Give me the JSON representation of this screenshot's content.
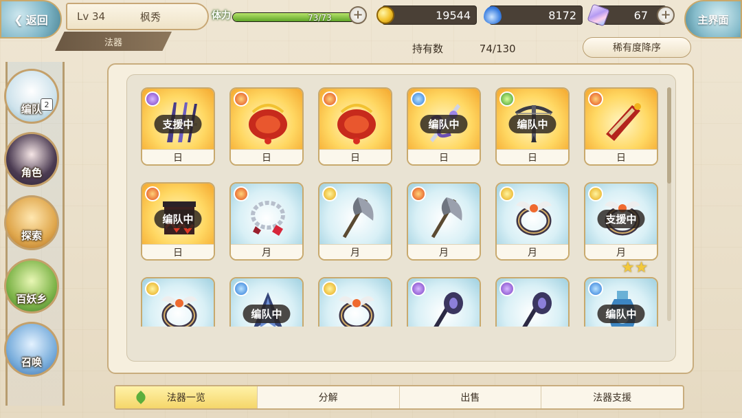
{
  "header": {
    "back_label": "返回",
    "level": "Lv 34",
    "player_name": "枫秀",
    "section": "法器",
    "stamina_label": "体力",
    "stamina_value": "73/73",
    "stamina_fraction": 1.0,
    "gold": "19544",
    "spirit": "8172",
    "gems": "67",
    "main_label": "主界面"
  },
  "toolbar": {
    "holding_label": "持有数",
    "holding_value": "74/130",
    "sort_label": "稀有度降序"
  },
  "nav": {
    "items": [
      {
        "label": "编队",
        "badge": "2"
      },
      {
        "label": "角色"
      },
      {
        "label": "探索"
      },
      {
        "label": "百妖乡"
      },
      {
        "label": "召唤"
      }
    ]
  },
  "grid": {
    "rows": [
      [
        {
          "element": "purple",
          "bg": "sun",
          "name": "日",
          "status": "支援中",
          "icon": "twin-blades-icon"
        },
        {
          "element": "red",
          "bg": "sun",
          "name": "日",
          "status": "",
          "icon": "red-dragon-artifact-icon"
        },
        {
          "element": "red",
          "bg": "sun",
          "name": "日",
          "status": "",
          "icon": "red-dragon-artifact-icon"
        },
        {
          "element": "blue",
          "bg": "sun",
          "name": "日",
          "status": "编队中",
          "icon": "serpent-sword-icon"
        },
        {
          "element": "green",
          "bg": "sun",
          "name": "日",
          "status": "编队中",
          "icon": "crossbow-icon"
        },
        {
          "element": "red",
          "bg": "sun",
          "name": "日",
          "status": "",
          "icon": "scroll-staff-icon"
        }
      ],
      [
        {
          "element": "red",
          "bg": "sun",
          "name": "日",
          "status": "编队中",
          "icon": "dark-banner-icon"
        },
        {
          "element": "red",
          "bg": "moon",
          "name": "月",
          "status": "",
          "icon": "chain-bracelet-icon"
        },
        {
          "element": "yellow",
          "bg": "moon",
          "name": "月",
          "status": "",
          "icon": "battle-axe-icon"
        },
        {
          "element": "red",
          "bg": "moon",
          "name": "月",
          "status": "",
          "icon": "battle-axe-icon"
        },
        {
          "element": "yellow",
          "bg": "moon",
          "name": "月",
          "status": "",
          "icon": "winged-ring-icon"
        },
        {
          "element": "yellow",
          "bg": "moon",
          "name": "月",
          "status": "支援中",
          "icon": "winged-ring-icon"
        }
      ],
      [
        {
          "element": "yellow",
          "bg": "moon",
          "name": "",
          "status": "",
          "icon": "winged-ring-icon"
        },
        {
          "element": "blue",
          "bg": "moon",
          "name": "",
          "status": "编队中",
          "icon": "blue-blade-icon"
        },
        {
          "element": "yellow",
          "bg": "moon",
          "name": "",
          "status": "",
          "icon": "winged-ring-icon"
        },
        {
          "element": "purple",
          "bg": "moon",
          "name": "",
          "status": "",
          "icon": "dark-staff-icon"
        },
        {
          "element": "purple",
          "bg": "moon",
          "name": "",
          "status": "",
          "icon": "dark-staff-icon"
        },
        {
          "element": "blue",
          "bg": "moon",
          "name": "",
          "status": "编队中",
          "icon": "blue-vase-icon",
          "stars": "★★"
        }
      ]
    ]
  },
  "tabs": [
    {
      "label": "法器一览",
      "active": true
    },
    {
      "label": "分解"
    },
    {
      "label": "出售"
    },
    {
      "label": "法器支援"
    }
  ],
  "colors": {
    "panel": "#f6efde",
    "border_gold": "#c8ac7d",
    "tab_active": "#f5d66a",
    "status_tag": "#28221e"
  }
}
